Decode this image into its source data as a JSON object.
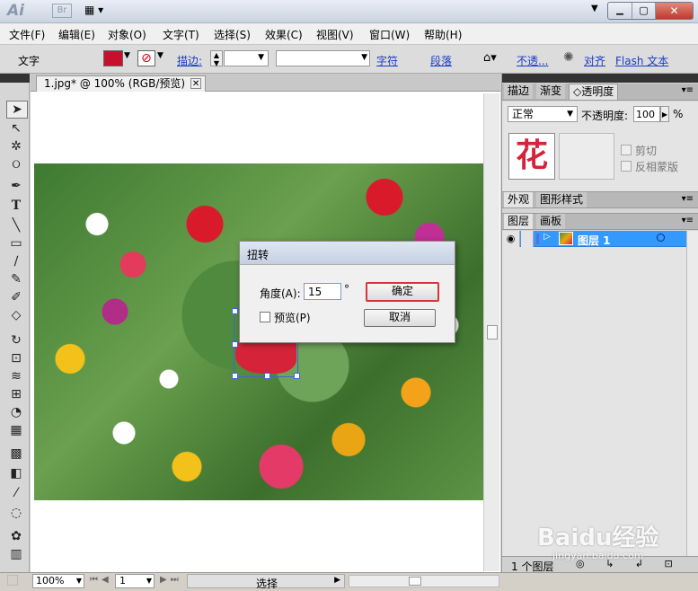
{
  "app": {
    "logo": "Ai",
    "bridge_label": "Br"
  },
  "window_controls": {
    "minimize": "▁",
    "maximize": "▢",
    "close": "✕"
  },
  "menu": [
    "文件(F)",
    "编辑(E)",
    "对象(O)",
    "文字(T)",
    "选择(S)",
    "效果(C)",
    "视图(V)",
    "窗口(W)",
    "帮助(H)"
  ],
  "control_bar": {
    "object_label": "文字",
    "fill_color": "#c8102e",
    "stroke_label": "描边:",
    "char_link": "字符",
    "para_link": "段落",
    "opacity_link": "不透...",
    "align_link": "对齐",
    "flash_link": "Flash 文本"
  },
  "document": {
    "tab_title": "1.jpg* @ 100% (RGB/预览)",
    "tab_close": "✕"
  },
  "dialog": {
    "title": "扭转",
    "angle_label": "角度(A):",
    "angle_value": "15",
    "degree_symbol": "°",
    "preview_label": "预览(P)",
    "ok_label": "确定",
    "cancel_label": "取消"
  },
  "panels": {
    "transparency_tabs": [
      "描边",
      "渐变",
      "◇透明度"
    ],
    "blend_mode": "正常",
    "opacity_label": "不透明度:",
    "opacity_value": "100",
    "opacity_unit": "%",
    "thumbnail_char": "花",
    "clip_label": "剪切",
    "invert_label": "反相蒙版",
    "appearance_tabs": [
      "外观",
      "图形样式"
    ],
    "layer_tabs": [
      "图层",
      "画板"
    ],
    "layer_name": "图层 1",
    "layer_count": "1 个图层"
  },
  "status": {
    "zoom": "100%",
    "page": "1",
    "mode": "选择"
  },
  "watermark": {
    "brand": "Baidu经验",
    "url": "jingyan.baidu.com"
  },
  "colors": {
    "accent": "#3399ff",
    "dialog_ok_border": "#d9333f",
    "selection": "#3a6ad0"
  }
}
